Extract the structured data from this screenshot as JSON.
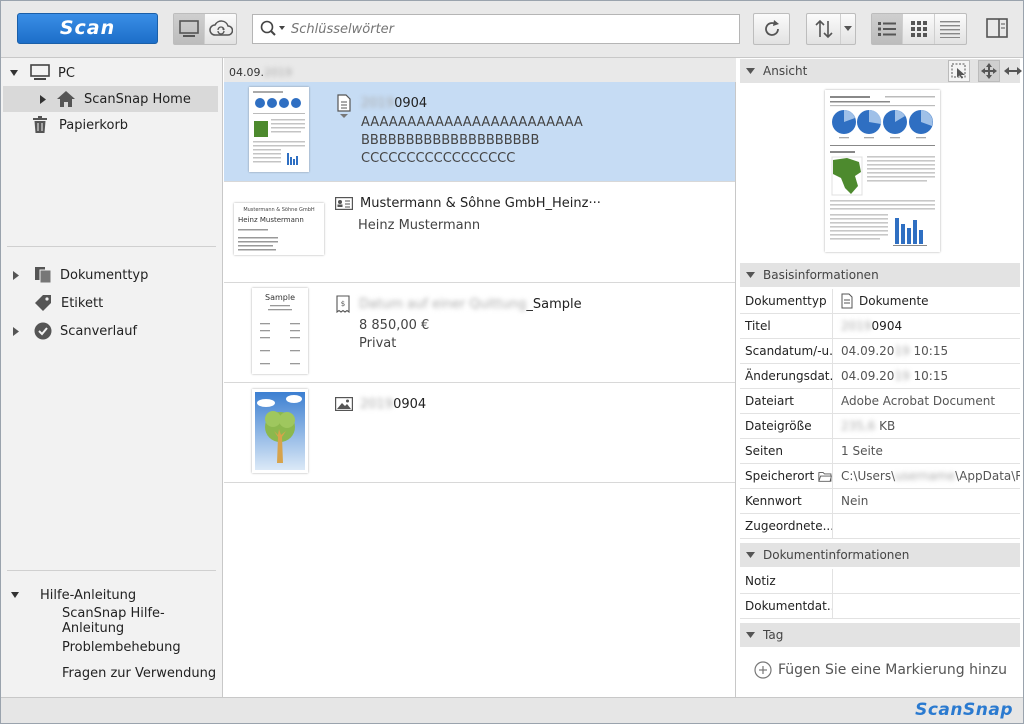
{
  "toolbar": {
    "scan_label": "Scan",
    "search_placeholder": "Schlüsselwörter"
  },
  "sidebar": {
    "pc_label": "PC",
    "scansnap_home_label": "ScanSnap Home",
    "trash_label": "Papierkorb",
    "doc_type_label": "Dokumenttyp",
    "tag_label": "Etikett",
    "scan_history_label": "Scanverlauf",
    "help_header": "Hilfe-Anleitung",
    "help_items": [
      "ScanSnap Hilfe-Anleitung",
      "Problembehebung",
      "Fragen zur Verwendung"
    ]
  },
  "list": {
    "date_prefix": "04.09.",
    "date_hidden": "2019",
    "items": [
      {
        "title_hidden": "2019",
        "title_suffix": "0904",
        "line1": "AAAAAAAAAAAAAAAAAAAAAAAA",
        "line2": "BBBBBBBBBBBBBBBBBBBB",
        "line3": "CCCCCCCCCCCCCCCCC"
      },
      {
        "title": "Mustermann & Sôhne GmbH_Heinz···",
        "line1": "Heinz Mustermann",
        "thumb_line1": "Mustermann & Söhne GmbH",
        "thumb_line2": "Heinz Mustermann"
      },
      {
        "title_hidden": "Datum auf einer Quittung",
        "title_suffix": "_Sample",
        "line1": "8 850,00 €",
        "line2": "Privat",
        "thumb_title": "Sample"
      },
      {
        "title_hidden": "2019",
        "title_suffix": "0904"
      }
    ]
  },
  "right": {
    "preview_header": "Ansicht",
    "basic_header": "Basisinformationen",
    "props": [
      {
        "k": "Dokumenttyp",
        "v": "Dokumente"
      },
      {
        "k": "Titel",
        "v_hidden": "2019",
        "v": "0904"
      },
      {
        "k": "Scandatum/-u...",
        "v": "04.09.20",
        "v_hidden": "19",
        "v2": " 10:15"
      },
      {
        "k": "Änderungsdat...",
        "v": "04.09.20",
        "v_hidden": "19",
        "v2": " 10:15"
      },
      {
        "k": "Dateiart",
        "v": "Adobe Acrobat Document"
      },
      {
        "k": "Dateigröße",
        "v_hidden": "235,6",
        "v": " KB"
      },
      {
        "k": "Seiten",
        "v": "1 Seite"
      },
      {
        "k": "Speicherort",
        "v": "C:\\Users\\",
        "v_hidden": "username",
        "v2": "\\AppData\\Roa..."
      },
      {
        "k": "Kennwort",
        "v": "Nein"
      },
      {
        "k": "Zugeordnete...",
        "v": ""
      }
    ],
    "docinfo_header": "Dokumentinformationen",
    "docinfo_props": [
      {
        "k": "Notiz",
        "v": ""
      },
      {
        "k": "Dokumentdat...",
        "v": ""
      }
    ],
    "tag_header": "Tag",
    "add_tag_label": "Fügen Sie eine Markierung hinzu"
  },
  "footer": {
    "logo_text": "ScanSnap"
  },
  "colors": {
    "accent": "#1d6ec9",
    "selection": "#c6dcf4",
    "chart_blue": "#2f6fc2"
  }
}
